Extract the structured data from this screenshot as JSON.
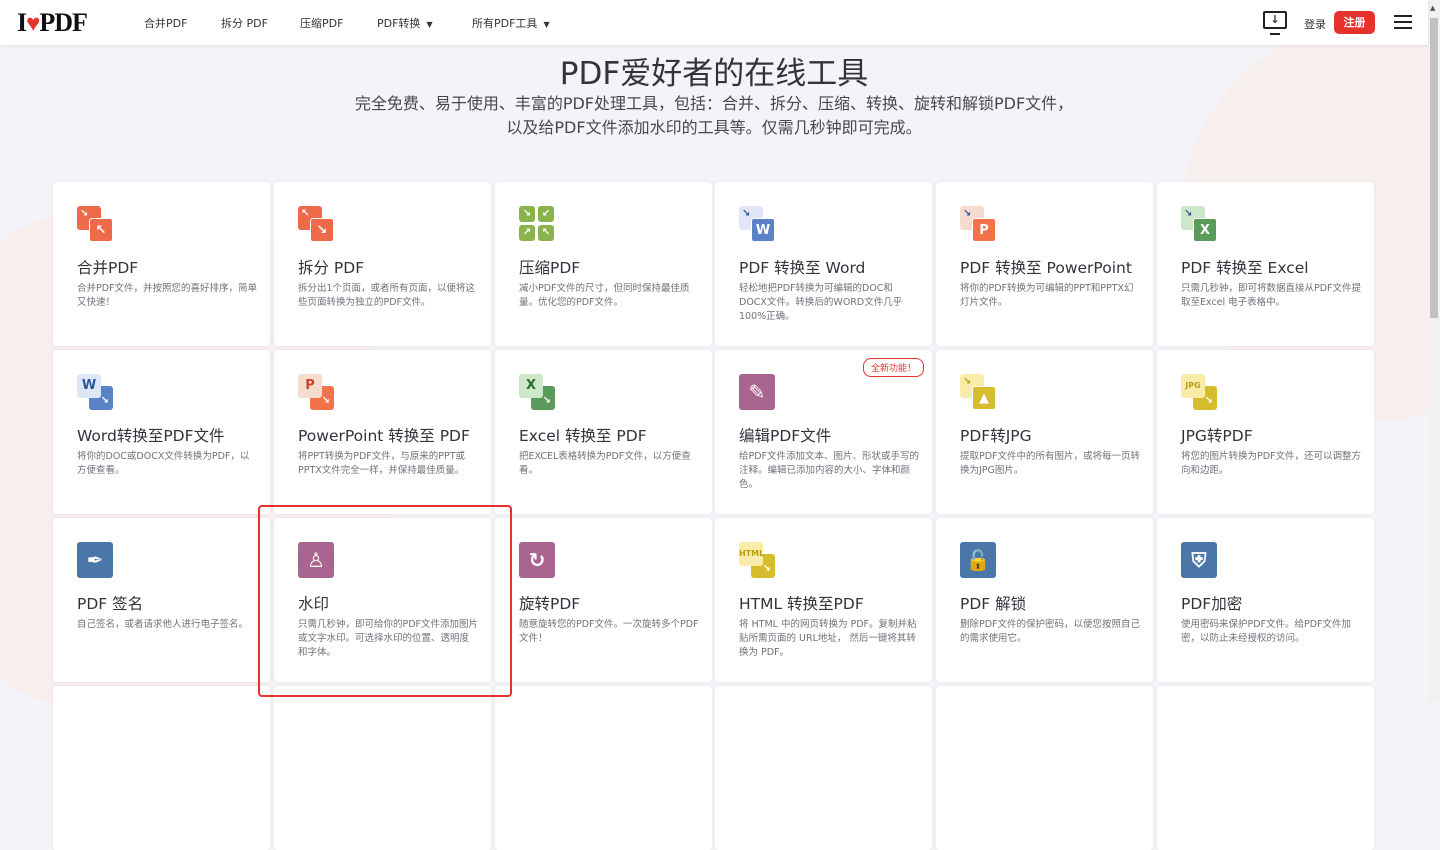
{
  "header": {
    "logo": "I♥PDF",
    "nav": [
      {
        "label": "合并PDF"
      },
      {
        "label": "拆分 PDF"
      },
      {
        "label": "压缩PDF"
      },
      {
        "label": "PDF转换",
        "dropdown": true
      },
      {
        "label": "所有PDF工具",
        "dropdown": true
      }
    ],
    "login": "登录",
    "register": "注册"
  },
  "hero": {
    "title": "PDF爱好者的在线工具",
    "subtitle": "完全免费、易于使用、丰富的PDF处理工具，包括：合并、拆分、压缩、转换、旋转和解锁PDF文件，以及给PDF文件添加水印的工具等。仅需几秒钟即可完成。"
  },
  "colors": {
    "accent": "#e5322d"
  },
  "tools": [
    {
      "title": "合并PDF",
      "desc": "合并PDF文件，并按照您的喜好排序，简单又快速！",
      "icon": "merge-icon",
      "back": "#ef6a4a",
      "front": "#ef6a4a",
      "fl": "↖",
      "bl": "↘"
    },
    {
      "title": "拆分 PDF",
      "desc": "拆分出1个页面，或者所有页面，以便将这些页面转换为独立的PDF文件。",
      "icon": "split-icon",
      "back": "#ef6a4a",
      "front": "#ef6a4a",
      "fl": "↘",
      "bl": "↖"
    },
    {
      "title": "压缩PDF",
      "desc": "减小PDF文件的尺寸，但同时保持最佳质量。优化您的PDF文件。",
      "icon": "compress-icon",
      "grid": "#8bb34d"
    },
    {
      "title": "PDF 转换至 Word",
      "desc": "轻松地把PDF转换为可编辑的DOC和DOCX文件。转换后的WORD文件几乎100%正确。",
      "icon": "pdf-to-word-icon",
      "back": "#dfe6f8",
      "front": "#5b82c6",
      "fl": "W",
      "bl": "↘"
    },
    {
      "title": "PDF 转换至 PowerPoint",
      "desc": "将你的PDF转换为可编辑的PPT和PPTX幻灯片文件。",
      "icon": "pdf-to-powerpoint-icon",
      "back": "#f6dccf",
      "front": "#f37249",
      "fl": "P",
      "bl": "↘"
    },
    {
      "title": "PDF 转换至 Excel",
      "desc": "只需几秒钟，即可将数据直接从PDF文件提取至Excel 电子表格中。",
      "icon": "pdf-to-excel-icon",
      "back": "#cce8c8",
      "front": "#5a9a5a",
      "fl": "X",
      "bl": "↘"
    },
    {
      "title": "Word转换至PDF文件",
      "desc": "将你的DOC或DOCX文件转换为PDF，以方便查看。",
      "icon": "word-to-pdf-icon",
      "back": "#5b82c6",
      "front": "#dfe6f8",
      "fl": "W",
      "bl": "↘",
      "rev": true,
      "fc": "#2b579a"
    },
    {
      "title": "PowerPoint 转换至 PDF",
      "desc": "将PPT转换为PDF文件，与原来的PPT或PPTX文件完全一样，并保持最佳质量。",
      "icon": "powerpoint-to-pdf-icon",
      "back": "#f37249",
      "front": "#f6dccf",
      "fl": "P",
      "bl": "↘",
      "rev": true,
      "fc": "#c8432a"
    },
    {
      "title": "Excel 转换至 PDF",
      "desc": "把EXCEL表格转换为PDF文件，以方便查看。",
      "icon": "excel-to-pdf-icon",
      "back": "#5a9a5a",
      "front": "#cce8c8",
      "fl": "X",
      "bl": "↘",
      "rev": true,
      "fc": "#2f6b2f"
    },
    {
      "title": "编辑PDF文件",
      "desc": "给PDF文件添加文本、图片、形状或手写的注释。编辑已添加内容的大小、字体和颜色。",
      "icon": "edit-pdf-icon",
      "single": "#a9658f",
      "sl": "✎",
      "badge": "全新功能！"
    },
    {
      "title": "PDF转JPG",
      "desc": "提取PDF文件中的所有图片，或将每一页转换为JPG图片。",
      "icon": "pdf-to-jpg-icon",
      "back": "#f9ecaa",
      "front": "#d6bd2e",
      "fl": "▲",
      "bl": "↘",
      "bc": "#b89f10"
    },
    {
      "title": "JPG转PDF",
      "desc": "将您的图片转换为PDF文件，还可以调整方向和边距。",
      "icon": "jpg-to-pdf-icon",
      "back": "#d6bd2e",
      "front": "#f9ecaa",
      "fl": "JPG",
      "bl": "↘",
      "rev": true,
      "fc": "#b89f10"
    },
    {
      "title": "PDF 签名",
      "desc": "自己签名，或者请求他人进行电子签名。",
      "icon": "sign-pen-icon",
      "single": "#4a77a8",
      "sl": "✒"
    },
    {
      "title": "水印",
      "desc": "只需几秒钟，即可给你的PDF文件添加图片或文字水印。可选择水印的位置、透明度和字体。",
      "icon": "watermark-stamp-icon",
      "single": "#a9658f",
      "sl": "♙"
    },
    {
      "title": "旋转PDF",
      "desc": "随意旋转您的PDF文件。一次旋转多个PDF文件！",
      "icon": "rotate-icon",
      "single": "#a9658f",
      "sl": "↻"
    },
    {
      "title": "HTML 转换至PDF",
      "desc": "将 HTML 中的网页转换为 PDF。复制并粘贴所需页面的 URL地址， 然后一键将其转换为 PDF。",
      "icon": "html-to-pdf-icon",
      "back": "#d6bd2e",
      "front": "#f9ecaa",
      "fl": "HTML",
      "bl": "↘",
      "rev": true,
      "fc": "#b89f10"
    },
    {
      "title": "PDF 解锁",
      "desc": "删除PDF文件的保护密码，以便您按照自己的需求使用它。",
      "icon": "unlock-icon",
      "single": "#4a77a8",
      "sl": "🔓"
    },
    {
      "title": "PDF加密",
      "desc": "使用密码来保护PDF文件。给PDF文件加密，以防止未经授权的访问。",
      "icon": "shield-lock-icon",
      "single": "#4a77a8",
      "sl": "⛨"
    }
  ]
}
